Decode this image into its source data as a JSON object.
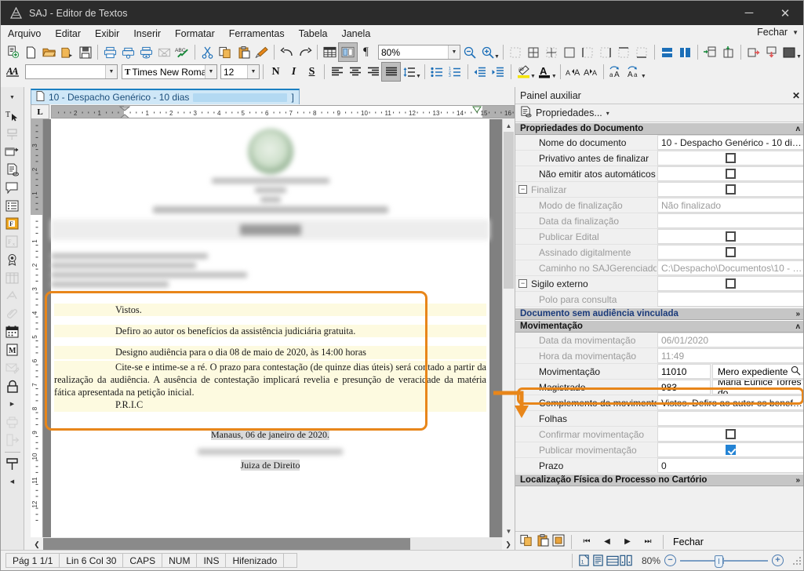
{
  "window": {
    "title": "SAJ - Editor de Textos",
    "minimize_label": "─",
    "close_label": "✕"
  },
  "menubar": {
    "items": [
      {
        "label": "Arquivo"
      },
      {
        "label": "Editar"
      },
      {
        "label": "Exibir"
      },
      {
        "label": "Inserir"
      },
      {
        "label": "Formatar"
      },
      {
        "label": "Ferramentas"
      },
      {
        "label": "Tabela"
      },
      {
        "label": "Janela"
      }
    ],
    "close_link": "Fechar"
  },
  "toolbar": {
    "zoom_value": "80%",
    "style_value": "",
    "font_value": "Times New Romar",
    "size_value": "12",
    "bold_label": "N",
    "italic_label": "I",
    "underline_label": "S",
    "icons": [
      "new-document-icon",
      "blank-page-icon",
      "open-folder-icon",
      "open-model-icon",
      "save-icon",
      "print-icon",
      "print-network-icon",
      "print-preview-icon",
      "send-mail-icon",
      "spellcheck-icon",
      "cut-icon",
      "copy-icon",
      "paste-icon",
      "format-painter-icon",
      "undo-icon",
      "redo-icon",
      "insert-table-icon",
      "page-layout-icon",
      "show-marks-icon"
    ]
  },
  "document_tab": {
    "label": "10 - Despacho Genérico - 10 dias",
    "suffix": "]"
  },
  "ruler": {
    "tab_stop_label": "L",
    "h_labels": [
      "2",
      "1",
      "1",
      "2",
      "3",
      "4",
      "5",
      "6",
      "7",
      "8",
      "9",
      "10",
      "11",
      "12",
      "13",
      "14",
      "15",
      "16"
    ],
    "v_labels": [
      "3",
      "2",
      "1",
      "1",
      "2",
      "3",
      "4",
      "5",
      "6",
      "7",
      "8",
      "9"
    ]
  },
  "document": {
    "paragraphs": [
      {
        "indent": true,
        "text": "Vistos."
      },
      {
        "indent": true,
        "text": "Defiro ao autor os benefícios da assistência judiciária gratuita."
      },
      {
        "indent": true,
        "text": "Designo audiência para o dia 08 de maio de 2020, às 14:00 horas"
      },
      {
        "indent": true,
        "text": "Cite-se e intime-se a ré. O prazo para contestação (de quinze dias úteis) será contado a partir da realização da audiência. A ausência de contestação implicará revelia e presunção de veracidade da matéria fática apresentada na petição inicial."
      },
      {
        "indent": true,
        "text": "P.R.I.C"
      }
    ],
    "signature_place_date": "Manaus, 06 de janeiro de 2020.",
    "signature_role": "Juiza de Direito"
  },
  "panel": {
    "title": "Painel auxiliar",
    "close_label": "✕",
    "tool_label": "Propriedades...",
    "tool_caret": "▾",
    "groups": [
      {
        "name": "Propriedades do Documento",
        "chevron": "»",
        "style": "normal",
        "rows": [
          {
            "label": "Nome do documento",
            "value": "10 - Despacho Genérico - 10 di…",
            "type": "text",
            "dim": false,
            "indent": "sub"
          },
          {
            "label": "Privativo antes de finalizar",
            "value": "",
            "type": "checkbox",
            "checked": false,
            "dim": false,
            "indent": "sub"
          },
          {
            "label": "Não emitir atos automáticos",
            "value": "",
            "type": "checkbox",
            "checked": false,
            "dim": false,
            "indent": "sub"
          },
          {
            "label": "Finalizar",
            "value": "",
            "type": "checkbox",
            "checked": false,
            "dim": true,
            "indent": "tree",
            "tree": "−"
          },
          {
            "label": "Modo de finalização",
            "value": "Não finalizado",
            "type": "text",
            "dim": true,
            "indent": "sub2"
          },
          {
            "label": "Data da finalização",
            "value": "",
            "type": "text",
            "dim": true,
            "indent": "sub2"
          },
          {
            "label": "Publicar Edital",
            "value": "",
            "type": "checkbox",
            "checked": false,
            "dim": true,
            "indent": "sub2"
          },
          {
            "label": "Assinado digitalmente",
            "value": "",
            "type": "checkbox",
            "checked": false,
            "dim": true,
            "indent": "sub"
          },
          {
            "label": "Caminho no SAJGerenciador",
            "value": "C:\\Despacho\\Documentos\\10 - …",
            "type": "text",
            "dim": true,
            "indent": "sub"
          },
          {
            "label": "Sigilo externo",
            "value": "",
            "type": "checkbox",
            "checked": false,
            "dim": false,
            "indent": "tree",
            "tree": "−"
          },
          {
            "label": "Polo para consulta",
            "value": "",
            "type": "text",
            "dim": true,
            "indent": "sub2"
          }
        ]
      },
      {
        "name": "Documento sem audiência vinculada",
        "chevron": "»",
        "style": "blue",
        "rows": []
      },
      {
        "name": "Movimentação",
        "chevron": "»",
        "style": "normal",
        "rows": [
          {
            "label": "Data da movimentação",
            "value": "06/01/2020",
            "type": "text",
            "dim": true,
            "indent": "sub"
          },
          {
            "label": "Hora da movimentação",
            "value": "11:49",
            "type": "text",
            "dim": true,
            "indent": "sub"
          },
          {
            "label": "Movimentação",
            "value": "11010",
            "value2": "Mero expediente",
            "type": "dual-search",
            "dim": false,
            "indent": "sub"
          },
          {
            "label": "Magistrado",
            "value": "983",
            "value2": "Maria Eunice Torres do …",
            "type": "dual",
            "dim": false,
            "indent": "sub"
          },
          {
            "label": "Complemento da movimentação",
            "value": "Vistos. Defiro ao autor os benef…",
            "type": "text",
            "dim": false,
            "indent": "sub",
            "highlighted": true
          },
          {
            "label": "Folhas",
            "value": "",
            "type": "text",
            "dim": false,
            "indent": "sub"
          },
          {
            "label": "Confirmar movimentação",
            "value": "",
            "type": "checkbox",
            "checked": false,
            "dim": true,
            "indent": "sub"
          },
          {
            "label": "Publicar movimentação",
            "value": "",
            "type": "checkbox",
            "checked": true,
            "dim": true,
            "indent": "sub"
          },
          {
            "label": "Prazo",
            "value": "0",
            "type": "text",
            "dim": false,
            "indent": "sub"
          }
        ]
      },
      {
        "name": "Localização Física do Processo no Cartório",
        "chevron": "»",
        "style": "normal",
        "rows": []
      }
    ],
    "footer": {
      "first_label": "⏮",
      "prev_label": "◀",
      "next_label": "▶",
      "last_label": "⏭",
      "close_label": "Fechar"
    }
  },
  "statusbar": {
    "page": "Pág 1   1/1",
    "position": "Lin 6  Col 30",
    "caps": "CAPS",
    "num": "NUM",
    "ins": "INS",
    "hyphen": "Hifenizado",
    "extra": "",
    "zoom": "80%",
    "zoom_out_label": "−",
    "zoom_in_label": "+"
  },
  "colors": {
    "accent_orange": "#e8861a",
    "highlight_yellow": "#fdfae0",
    "panel_group_bg": "#c6c6c6",
    "titlebar_bg": "#2b2b2b",
    "checkbox_blue": "#2383d4",
    "tab_blue": "#1a7fc1"
  }
}
